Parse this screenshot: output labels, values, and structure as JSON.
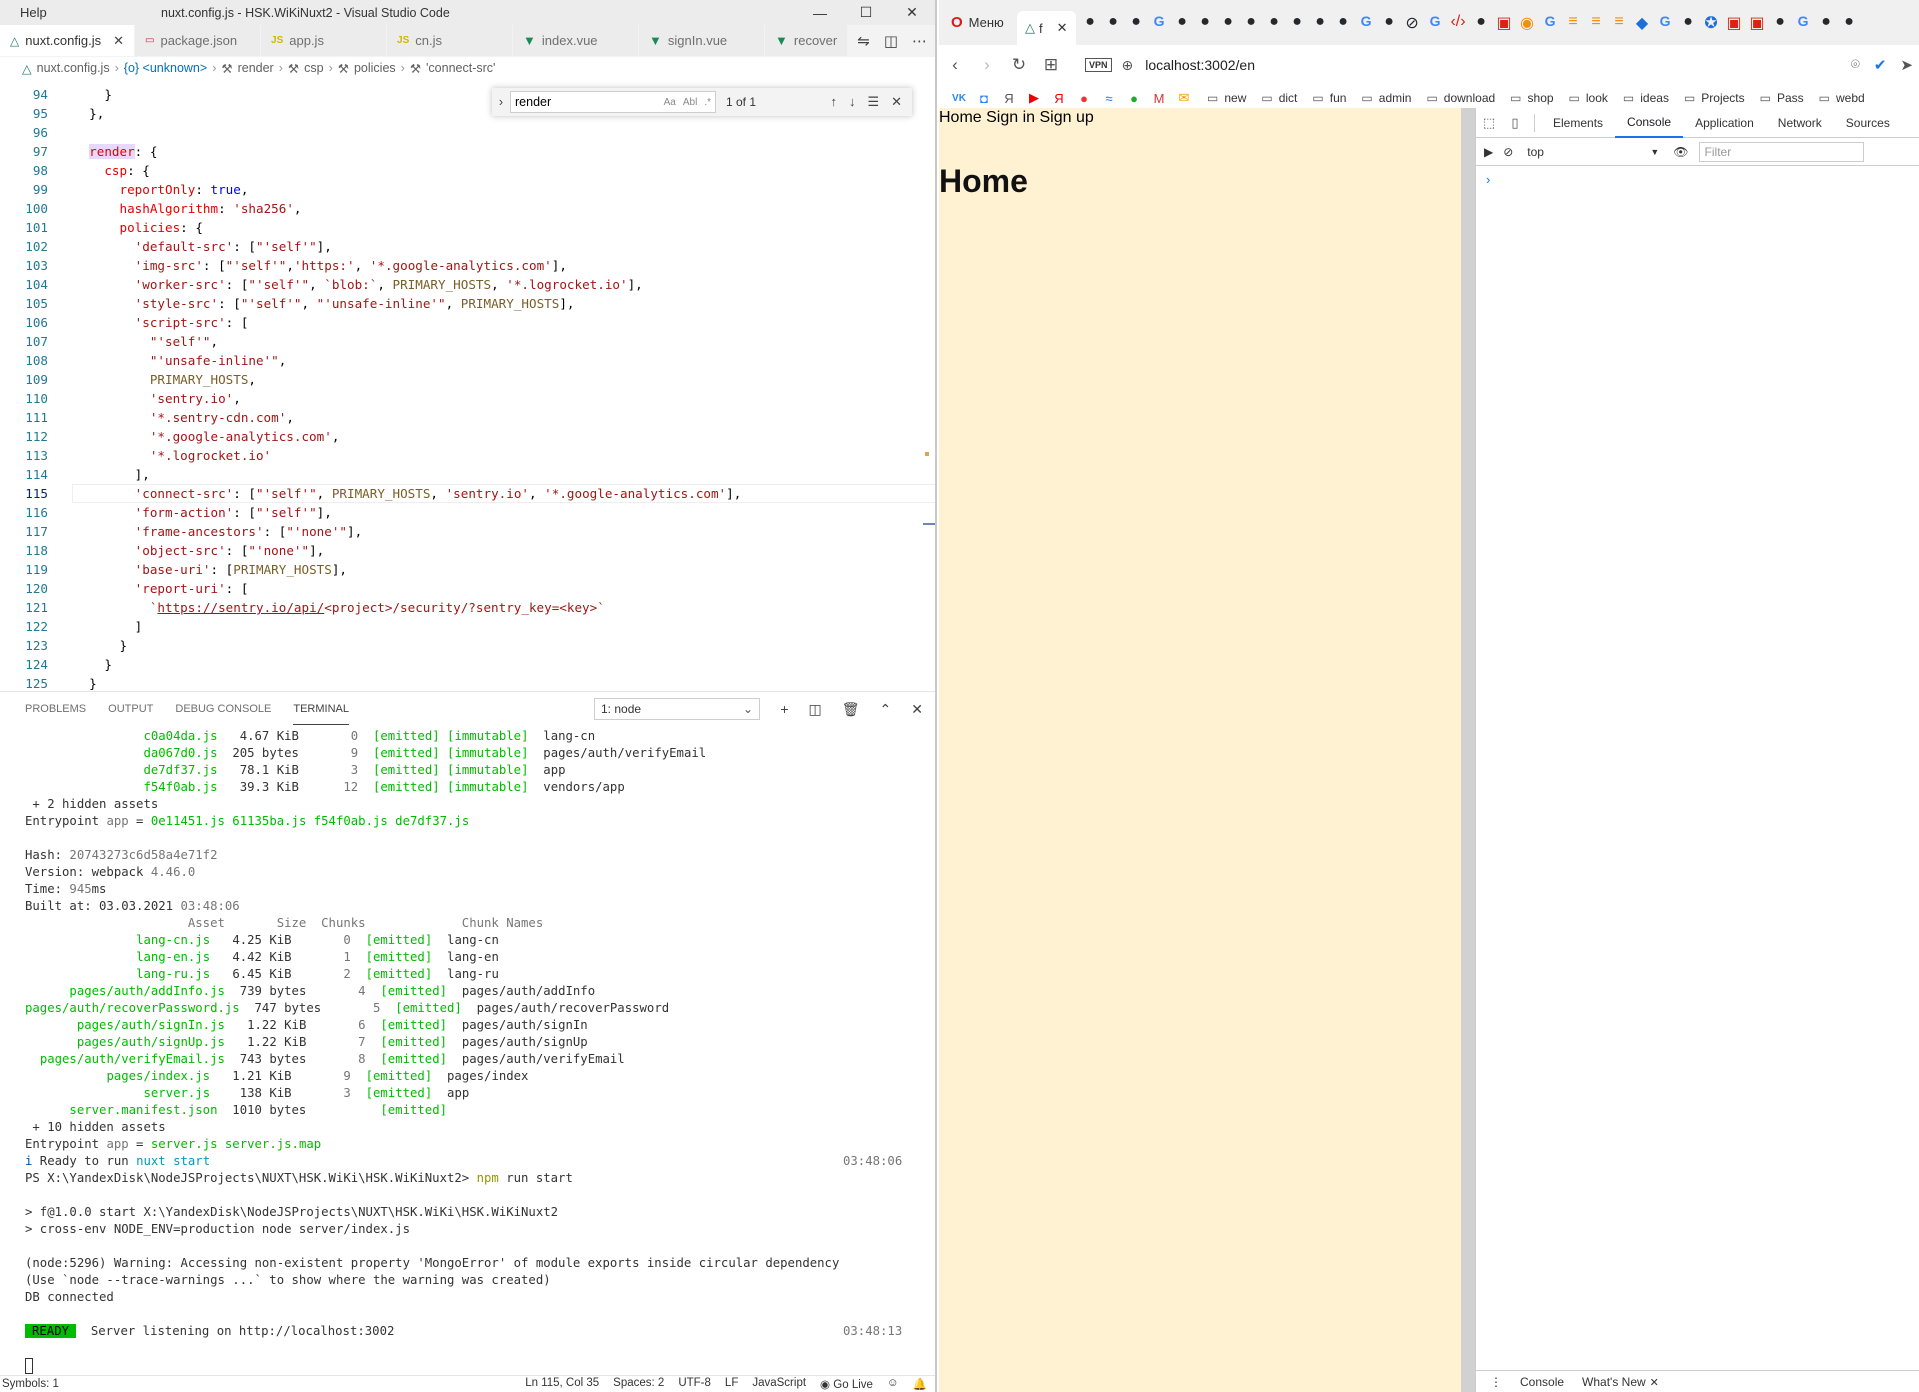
{
  "vscode": {
    "menu_help": "Help",
    "title": "nuxt.config.js - HSK.WiKiNuxt2 - Visual Studio Code",
    "tabs": [
      {
        "label": "nuxt.config.js",
        "icon": "nuxt-icon",
        "active": true
      },
      {
        "label": "package.json",
        "icon": "json-icon"
      },
      {
        "label": "app.js",
        "icon": "js-icon"
      },
      {
        "label": "cn.js",
        "icon": "js-icon"
      },
      {
        "label": "index.vue",
        "icon": "vue-icon"
      },
      {
        "label": "signIn.vue",
        "icon": "vue-icon"
      },
      {
        "label": "recover",
        "icon": "vue-icon"
      }
    ],
    "breadcrumb": [
      "nuxt.config.js",
      "{o} <unknown>",
      "render",
      "csp",
      "policies",
      "'connect-src'"
    ],
    "find": {
      "query": "render",
      "count": "1 of 1",
      "opt_case": "Aa",
      "opt_word": "Abl",
      "opt_regex": ".*"
    },
    "panel_tabs": [
      "Problems",
      "Output",
      "Debug Console",
      "Terminal"
    ],
    "terminal_select": "1: node",
    "status": {
      "symbols": "Symbols: 1",
      "position": "Ln 115, Col 35",
      "spaces": "Spaces: 2",
      "encoding": "UTF-8",
      "eol": "LF",
      "language": "JavaScript",
      "golive": "Go Live"
    }
  },
  "browser": {
    "menu_label": "Меню",
    "active_tab_label": "f",
    "url_host": "localhost:3002/en",
    "bookmarks_folders": [
      "new",
      "dict",
      "fun",
      "admin",
      "download",
      "shop",
      "look",
      "ideas",
      "Projects",
      "Pass",
      "webd"
    ],
    "page": {
      "nav": "Home Sign in Sign up",
      "heading": "Home"
    },
    "devtools": {
      "tabs": [
        "Elements",
        "Console",
        "Application",
        "Network",
        "Sources"
      ],
      "context": "top",
      "filter_placeholder": "Filter",
      "drawer_tabs": [
        "Console",
        "What's New"
      ]
    }
  }
}
